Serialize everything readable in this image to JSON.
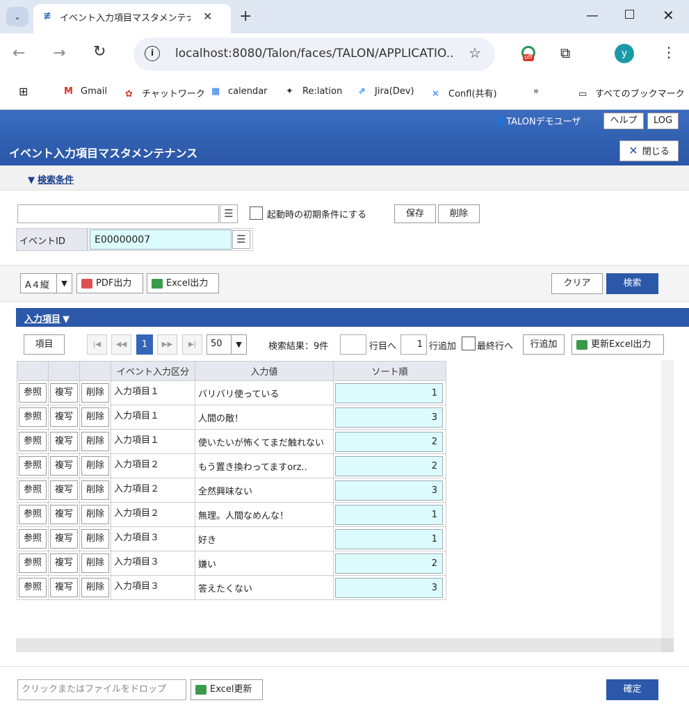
{
  "browser": {
    "tab_title": "イベント入力項目マスタメンテナンス",
    "url": "localhost:8080/Talon/faces/TALON/APPLICATIO...",
    "profile_initial": "y",
    "extension_badge": "off",
    "bookmarks": [
      {
        "label": "Gmail",
        "icon": "gmail-icon"
      },
      {
        "label": "チャットワーク",
        "icon": "chatwork-icon"
      },
      {
        "label": "calendar",
        "icon": "calendar-icon"
      },
      {
        "label": "Re:lation",
        "icon": "relation-icon"
      },
      {
        "label": "Jira(Dev)",
        "icon": "jira-icon"
      },
      {
        "label": "Confl(共有)",
        "icon": "confluence-icon"
      }
    ],
    "more_bookmarks": "»",
    "all_bookmarks": "すべてのブックマーク"
  },
  "header": {
    "user": "TALONデモユーザ",
    "help": "ヘルプ",
    "log": "LOG",
    "page_title": "イベント入力項目マスタメンテナンス",
    "close": "閉じる"
  },
  "search": {
    "toggle": "検索条件",
    "init_condition": "起動時の初期条件にする",
    "save": "保存",
    "delete": "削除",
    "event_id_label": "イベントID",
    "event_id_value": "E00000007"
  },
  "output": {
    "paper": "A４縦",
    "pdf": "PDF出力",
    "excel": "Excel出力",
    "clear": "クリア",
    "search": "検索"
  },
  "results": {
    "title": "入力項目",
    "item_btn": "項目",
    "page_current": "1",
    "per_page": "50",
    "count_text": "検索結果：9件",
    "jump_label": "行目へ",
    "add_count": "1",
    "add_label": "行追加",
    "last_row_label": "最終行へ",
    "add_row_btn": "行追加",
    "excel_update_out": "更新Excel出力",
    "columns": [
      "イベント入力区分",
      "入力値",
      "ソート順"
    ],
    "row_buttons": [
      "参照",
      "複写",
      "削除"
    ],
    "rows": [
      {
        "kind": "入力項目１",
        "value": "バリバリ使っている",
        "sort": "1"
      },
      {
        "kind": "入力項目１",
        "value": "人間の敵！",
        "sort": "3"
      },
      {
        "kind": "入力項目１",
        "value": "使いたいが怖くてまだ触れない",
        "sort": "2"
      },
      {
        "kind": "入力項目２",
        "value": "もう置き換わってますorz..",
        "sort": "2"
      },
      {
        "kind": "入力項目２",
        "value": "全然興味ない",
        "sort": "3"
      },
      {
        "kind": "入力項目２",
        "value": "無理。人間なめんな！",
        "sort": "1"
      },
      {
        "kind": "入力項目３",
        "value": "好き",
        "sort": "1"
      },
      {
        "kind": "入力項目３",
        "value": "嫌い",
        "sort": "2"
      },
      {
        "kind": "入力項目３",
        "value": "答えたくない",
        "sort": "3"
      }
    ]
  },
  "footer": {
    "drop_zone": "クリックまたはファイルをドロップ",
    "excel_update": "Excel更新",
    "confirm": "確定"
  },
  "colors": {
    "header_blue": "#2b58a8",
    "input_cyan": "#dcfbfd"
  }
}
